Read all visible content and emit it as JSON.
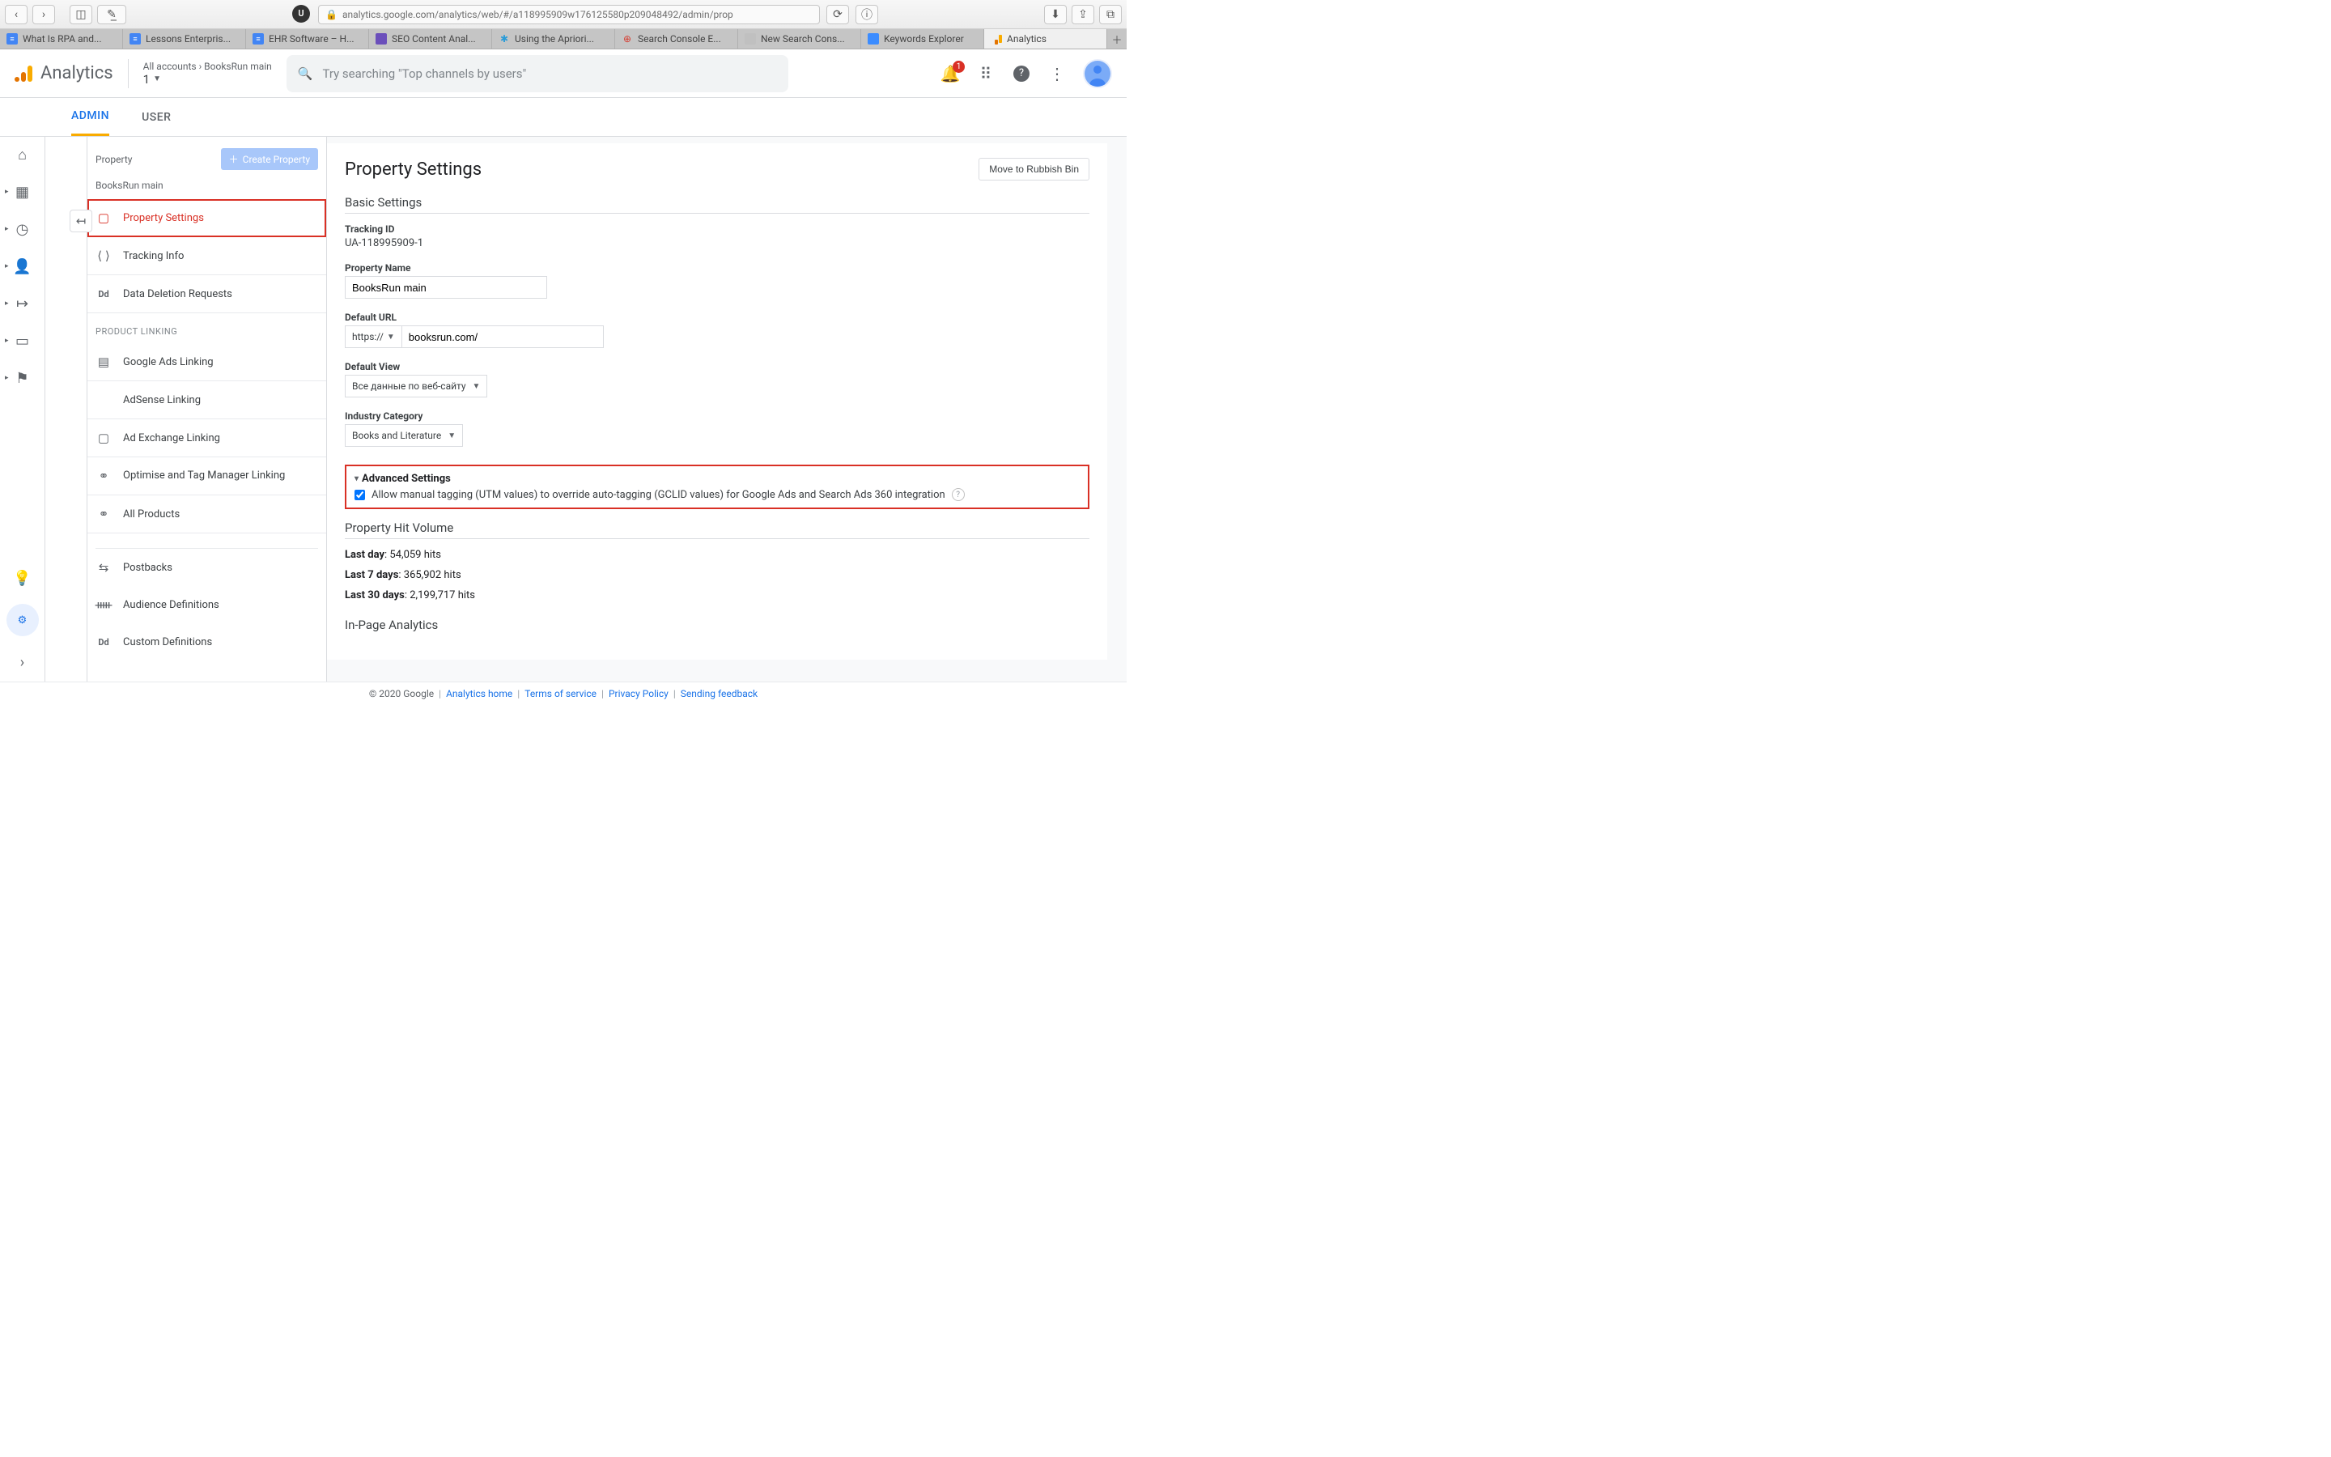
{
  "browser": {
    "url": "analytics.google.com/analytics/web/#/a118995909w176125580p209048492/admin/prop",
    "ext_badge": "U",
    "tabs": [
      {
        "label": "What Is RPA and...",
        "fav": "doc"
      },
      {
        "label": "Lessons Enterpris...",
        "fav": "doc"
      },
      {
        "label": "EHR Software – H...",
        "fav": "doc"
      },
      {
        "label": "SEO Content Anal...",
        "fav": "purple"
      },
      {
        "label": "Using the Apriori...",
        "fav": "cog"
      },
      {
        "label": "Search Console E...",
        "fav": "red"
      },
      {
        "label": "New Search Cons...",
        "fav": "grey"
      },
      {
        "label": "Keywords Explorer",
        "fav": "blue"
      },
      {
        "label": "Analytics",
        "fav": "ga",
        "active": true
      }
    ]
  },
  "header": {
    "product": "Analytics",
    "crumb1": "All accounts",
    "crumb2": "BooksRun main",
    "account_sel": "1",
    "search_placeholder": "Try searching \"Top channels by users\"",
    "notif_count": "1"
  },
  "subtabs": {
    "admin": "ADMIN",
    "user": "USER"
  },
  "rail": {
    "home": "home",
    "custom": "custom",
    "realtime": "realtime",
    "audience": "audience",
    "acq": "acq",
    "conv": "conv",
    "flag": "flag",
    "hint": "hint",
    "settings": "settings",
    "collapse": "collapse"
  },
  "property": {
    "head": "Property",
    "create": "Create Property",
    "name": "BooksRun main",
    "items": [
      {
        "label": "Property Settings",
        "active": true,
        "icon": "settings"
      },
      {
        "label": "Tracking Info",
        "icon": "code"
      },
      {
        "label": "Data Deletion Requests",
        "icon": "dd"
      }
    ],
    "link_section": "PRODUCT LINKING",
    "link_items": [
      {
        "label": "Google Ads Linking",
        "icon": "ads"
      },
      {
        "label": "AdSense Linking",
        "icon": "blank"
      },
      {
        "label": "Ad Exchange Linking",
        "icon": "exchange"
      },
      {
        "label": "Optimise and Tag Manager Linking",
        "icon": "link"
      },
      {
        "label": "All Products",
        "icon": "link"
      }
    ],
    "extra_items": [
      {
        "label": "Postbacks",
        "icon": "post"
      },
      {
        "label": "Audience Definitions",
        "icon": "aud"
      },
      {
        "label": "Custom Definitions",
        "icon": "dd"
      }
    ]
  },
  "panel": {
    "title": "Property Settings",
    "rubbish": "Move to Rubbish Bin",
    "basic": "Basic Settings",
    "tracking_lbl": "Tracking ID",
    "tracking_val": "UA-118995909-1",
    "propname_lbl": "Property Name",
    "propname_val": "BooksRun main",
    "url_lbl": "Default URL",
    "url_proto": "https://",
    "url_val": "booksrun.com/",
    "view_lbl": "Default View",
    "view_val": "Все данные по веб-сайту",
    "cat_lbl": "Industry Category",
    "cat_val": "Books and Literature",
    "adv_title": "Advanced Settings",
    "adv_check": "Allow manual tagging (UTM values) to override auto-tagging (GCLID values) for Google Ads and Search Ads 360 integration",
    "hitvol": "Property Hit Volume",
    "hit_day_lbl": "Last day",
    "hit_day_val": ": 54,059 hits",
    "hit_7_lbl": "Last 7 days",
    "hit_7_val": ": 365,902 hits",
    "hit_30_lbl": "Last 30 days",
    "hit_30_val": ": 2,199,717 hits",
    "inpage": "In-Page Analytics"
  },
  "footer": {
    "copyright": "© 2020 Google",
    "home": "Analytics home",
    "terms": "Terms of service",
    "privacy": "Privacy Policy",
    "feedback": "Sending feedback"
  }
}
